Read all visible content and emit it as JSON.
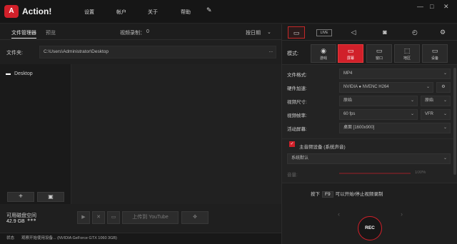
{
  "app": {
    "logo_text": "A",
    "name": "Action!"
  },
  "menu": [
    "设置",
    "帐户",
    "关于",
    "帮助"
  ],
  "window_controls": [
    "—",
    "□",
    "✕"
  ],
  "left": {
    "tabs": [
      "文件管理器",
      "预览"
    ],
    "recorded_label": "视频录制：",
    "recorded_count": "0",
    "sort_label": "按日期",
    "folder_label": "文件夹:",
    "folder_path": "C:\\Users\\Administrator\\Desktop",
    "more": "...",
    "tree_item": "Desktop",
    "add_btn": "+",
    "disk_label": "可用磁盘空间",
    "disk_value": "42.9 GB",
    "upload_btn": "上传到 YouTube",
    "status_label": "状态",
    "status_text": "观察开始使用设备...  (NVIDIA GeForce GTX 1060 3GB)"
  },
  "right": {
    "tabs": [
      {
        "name": "tab-video",
        "icon": "▭"
      },
      {
        "name": "tab-live",
        "icon": "LIVE"
      },
      {
        "name": "tab-audio",
        "icon": "◁"
      },
      {
        "name": "tab-screenshot",
        "icon": "◙"
      },
      {
        "name": "tab-timer",
        "icon": "◴"
      },
      {
        "name": "tab-settings",
        "icon": "⚙"
      }
    ],
    "mode_label": "模式:",
    "modes": [
      {
        "icon": "◉",
        "label": "游戏"
      },
      {
        "icon": "▭",
        "label": "屏幕"
      },
      {
        "icon": "▭",
        "label": "窗口"
      },
      {
        "icon": "⬚",
        "label": "地区"
      },
      {
        "icon": "▭",
        "label": "设备"
      }
    ],
    "settings": [
      {
        "label": "文件格式:",
        "value": "MP4"
      },
      {
        "label": "硬件加速:",
        "value": "NVIDIA ● NVENC H264"
      },
      {
        "label": "视频尺寸:",
        "value": "原始",
        "extra": "原始"
      },
      {
        "label": "视频帧率:",
        "value": "60 fps",
        "extra": "VFR"
      },
      {
        "label": "活动屏幕:",
        "value": "桌面 [1600x900]"
      }
    ],
    "audio_device": "主音频设备 (系统声音)",
    "audio_default": "系统默认",
    "volume_label": "音量:",
    "volume_value": "100%",
    "hotkey_prefix": "按下",
    "hotkey": "F9",
    "hotkey_suffix": "可以开始/停止视频录制",
    "rec": "REC"
  }
}
